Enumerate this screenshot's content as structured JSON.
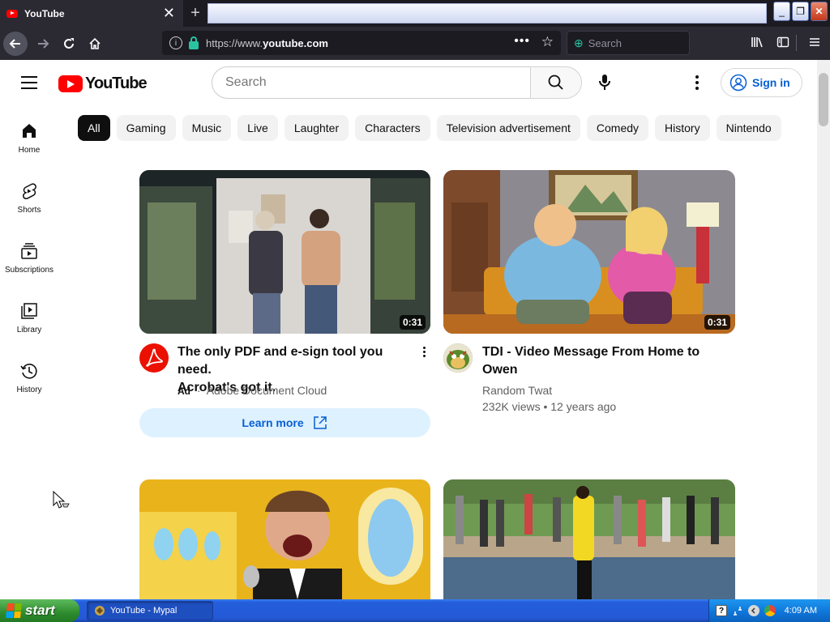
{
  "browser": {
    "tab_title": "YouTube",
    "tab_close": "✕",
    "new_tab": "+",
    "url_prefix": "https://www.",
    "url_domain": "youtube.com",
    "search_placeholder": "Search",
    "url_dots": "•••",
    "window_buttons": [
      "_",
      "❐",
      "✕"
    ]
  },
  "youtube": {
    "logo_text": "YouTube",
    "search_placeholder": "Search",
    "sign_in_label": "Sign in",
    "chips": [
      "All",
      "Gaming",
      "Music",
      "Live",
      "Laughter",
      "Characters",
      "Television advertisement",
      "Comedy",
      "History",
      "Nintendo"
    ],
    "active_chip": "All",
    "sidebar": [
      {
        "label": "Home",
        "icon": "home-icon"
      },
      {
        "label": "Shorts",
        "icon": "shorts-icon"
      },
      {
        "label": "Subscriptions",
        "icon": "subscriptions-icon"
      },
      {
        "label": "Library",
        "icon": "library-icon"
      },
      {
        "label": "History",
        "icon": "history-icon"
      }
    ],
    "videos": [
      {
        "title_line1": "The only PDF and e-sign tool you need.",
        "title_line2": "Acrobat's got it.",
        "ad_label": "Ad",
        "separator": "·",
        "channel": "Adobe Document Cloud",
        "duration": "0:31",
        "cta": "Learn more"
      },
      {
        "title_line1": "TDI - Video Message From Home to",
        "title_line2": "Owen",
        "channel": "Random Twat",
        "stats": "232K views • 12 years ago",
        "duration": "0:31"
      }
    ]
  },
  "taskbar": {
    "start_label": "start",
    "task_label": "YouTube - Mypal",
    "clock": "4:09 AM"
  },
  "colors": {
    "youtube_red": "#ff0000",
    "link_blue": "#065fd4",
    "browser_dark": "#2b2a33",
    "xp_blue": "#245edb",
    "xp_green": "#2e8b2e"
  }
}
